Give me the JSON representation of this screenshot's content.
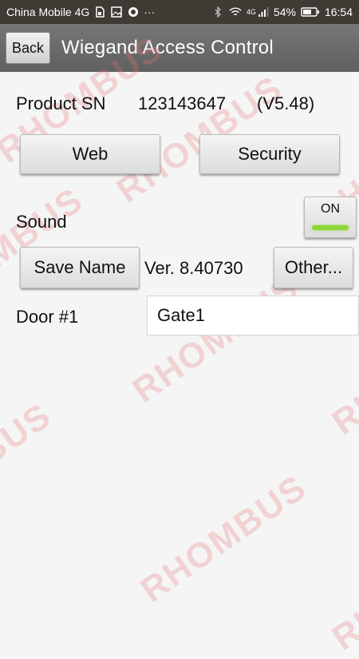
{
  "status_bar": {
    "carrier": "China Mobile 4G",
    "network_label": "4G",
    "battery": "54%",
    "time": "16:54",
    "more": "···"
  },
  "action_bar": {
    "back_label": "Back",
    "title": "Wiegand Access Control"
  },
  "product": {
    "label": "Product SN",
    "serial": "123143647",
    "version": "(V5.48)"
  },
  "buttons": {
    "web": "Web",
    "security": "Security",
    "save_name": "Save Name",
    "other": "Other..."
  },
  "sound": {
    "label": "Sound",
    "toggle_state": "ON",
    "indicator_color": "#8fd63a"
  },
  "version_text": "Ver. 8.40730",
  "door": {
    "label": "Door #1",
    "value": "Gate1"
  },
  "watermark": "RHOMBUS"
}
